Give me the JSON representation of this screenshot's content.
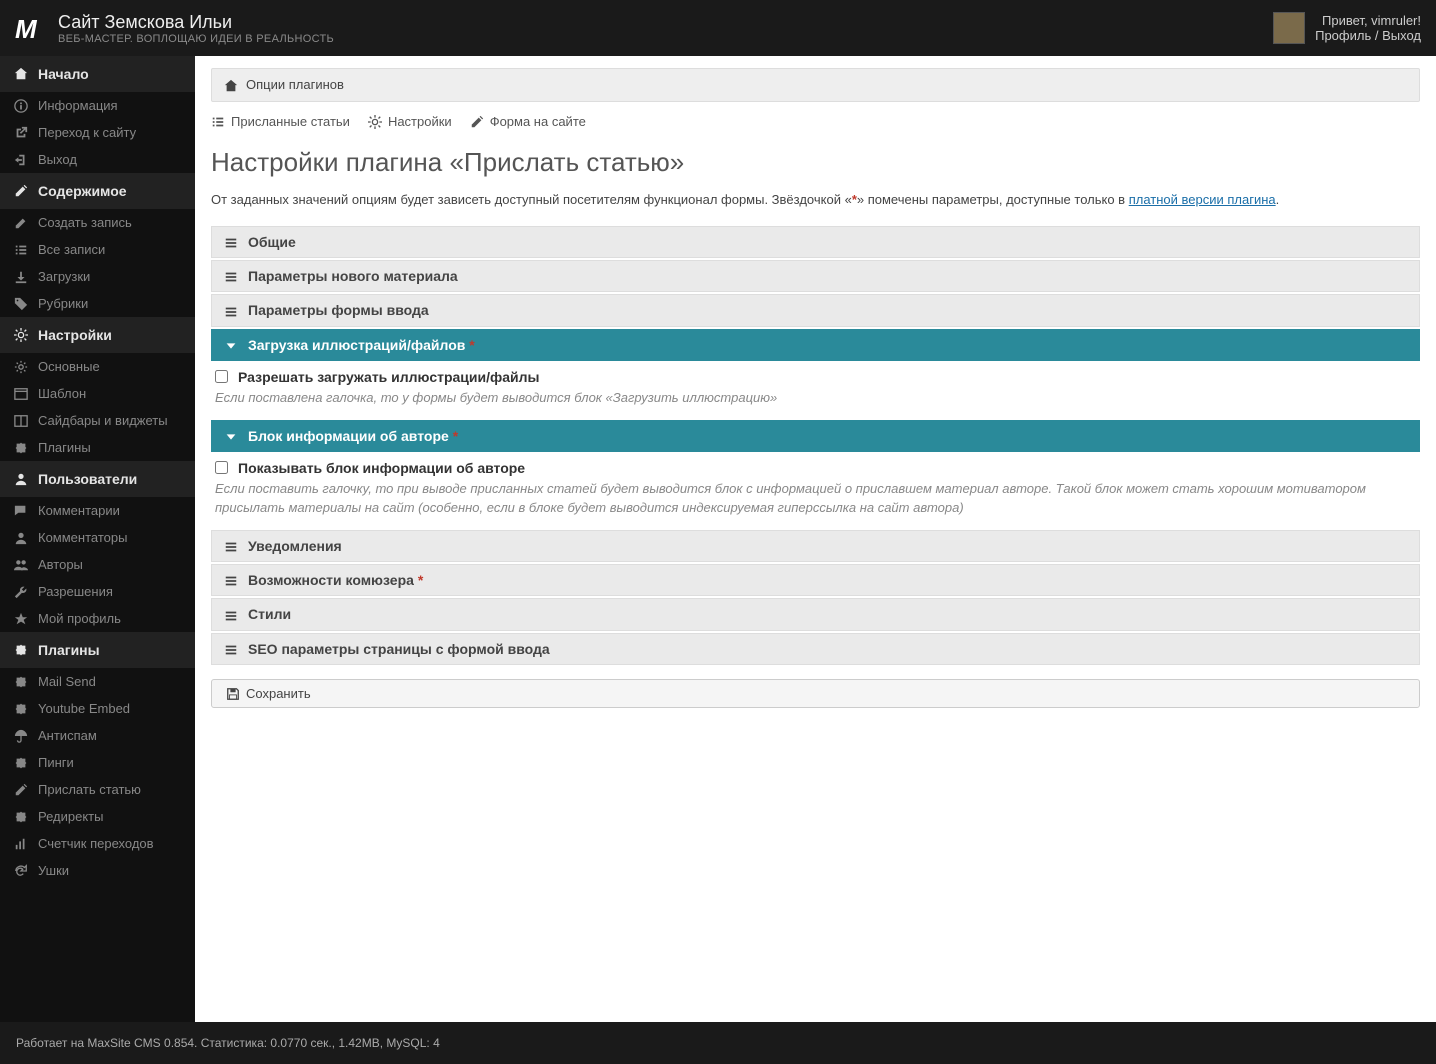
{
  "header": {
    "site_title": "Сайт Земскова Ильи",
    "site_subtitle": "Веб-мастер. Воплощаю идеи в реальность",
    "greeting": "Привет, vimruler!",
    "profile_link": "Профиль",
    "logout_link": "Выход"
  },
  "sidebar": {
    "groups": [
      {
        "title": "Начало",
        "icon": "home",
        "items": [
          {
            "label": "Информация",
            "icon": "info"
          },
          {
            "label": "Переход к сайту",
            "icon": "external"
          },
          {
            "label": "Выход",
            "icon": "exit"
          }
        ]
      },
      {
        "title": "Содержимое",
        "icon": "edit",
        "items": [
          {
            "label": "Создать запись",
            "icon": "pencil"
          },
          {
            "label": "Все записи",
            "icon": "list"
          },
          {
            "label": "Загрузки",
            "icon": "download"
          },
          {
            "label": "Рубрики",
            "icon": "tags"
          }
        ]
      },
      {
        "title": "Настройки",
        "icon": "cogs",
        "items": [
          {
            "label": "Основные",
            "icon": "cog"
          },
          {
            "label": "Шаблон",
            "icon": "layout"
          },
          {
            "label": "Сайдбары и виджеты",
            "icon": "columns"
          },
          {
            "label": "Плагины",
            "icon": "puzzle"
          }
        ]
      },
      {
        "title": "Пользователи",
        "icon": "user",
        "items": [
          {
            "label": "Комментарии",
            "icon": "comments"
          },
          {
            "label": "Комментаторы",
            "icon": "user"
          },
          {
            "label": "Авторы",
            "icon": "users"
          },
          {
            "label": "Разрешения",
            "icon": "wrench"
          },
          {
            "label": "Мой профиль",
            "icon": "star"
          }
        ]
      },
      {
        "title": "Плагины",
        "icon": "puzzle",
        "items": [
          {
            "label": "Mail Send",
            "icon": "puzzle"
          },
          {
            "label": "Youtube Embed",
            "icon": "puzzle"
          },
          {
            "label": "Антиспам",
            "icon": "umbrella"
          },
          {
            "label": "Пинги",
            "icon": "puzzle"
          },
          {
            "label": "Прислать статью",
            "icon": "edit"
          },
          {
            "label": "Редиректы",
            "icon": "puzzle"
          },
          {
            "label": "Счетчик переходов",
            "icon": "bars"
          },
          {
            "label": "Ушки",
            "icon": "refresh"
          }
        ]
      }
    ]
  },
  "breadcrumb": {
    "label": "Опции плагинов"
  },
  "subnav": [
    {
      "label": "Присланные статьи",
      "icon": "list"
    },
    {
      "label": "Настройки",
      "icon": "cogs"
    },
    {
      "label": "Форма на сайте",
      "icon": "edit"
    }
  ],
  "page": {
    "title": "Настройки плагина «Прислать статью»",
    "desc_before": "От заданных значений опциям будет зависеть доступный посетителям функционал формы. Звёздочкой «",
    "desc_after": "» помечены параметры, доступные только в ",
    "desc_link": "платной версии плагина",
    "desc_end": "."
  },
  "panels": [
    {
      "title": "Общие",
      "open": false,
      "star": false
    },
    {
      "title": "Параметры нового материала",
      "open": false,
      "star": false
    },
    {
      "title": "Параметры формы ввода",
      "open": false,
      "star": false
    },
    {
      "title": "Загрузка иллюстраций/файлов",
      "open": true,
      "star": true,
      "check_label": "Разрешать загружать иллюстрации/файлы",
      "hint": "Если поставлена галочка, то у формы будет выводится блок «Загрузить иллюстрацию»"
    },
    {
      "title": "Блок информации об авторе",
      "open": true,
      "star": true,
      "check_label": "Показывать блок информации об авторе",
      "hint": "Если поставить галочку, то при выводе присланных статей будет выводится блок с информацией о приславшем материал авторе. Такой блок может стать хорошим мотиватором присылать материалы на сайт (особенно, если в блоке будет выводится индексируемая гиперссылка на сайт автора)"
    },
    {
      "title": "Уведомления",
      "open": false,
      "star": false
    },
    {
      "title": "Возможности комюзера",
      "open": false,
      "star": true
    },
    {
      "title": "Стили",
      "open": false,
      "star": false
    },
    {
      "title": "SEO параметры страницы с формой ввода",
      "open": false,
      "star": false
    }
  ],
  "save_button": "Сохранить",
  "footer": "Работает на MaxSite CMS 0.854. Статистика: 0.0770 сек., 1.42MB, MySQL: 4"
}
